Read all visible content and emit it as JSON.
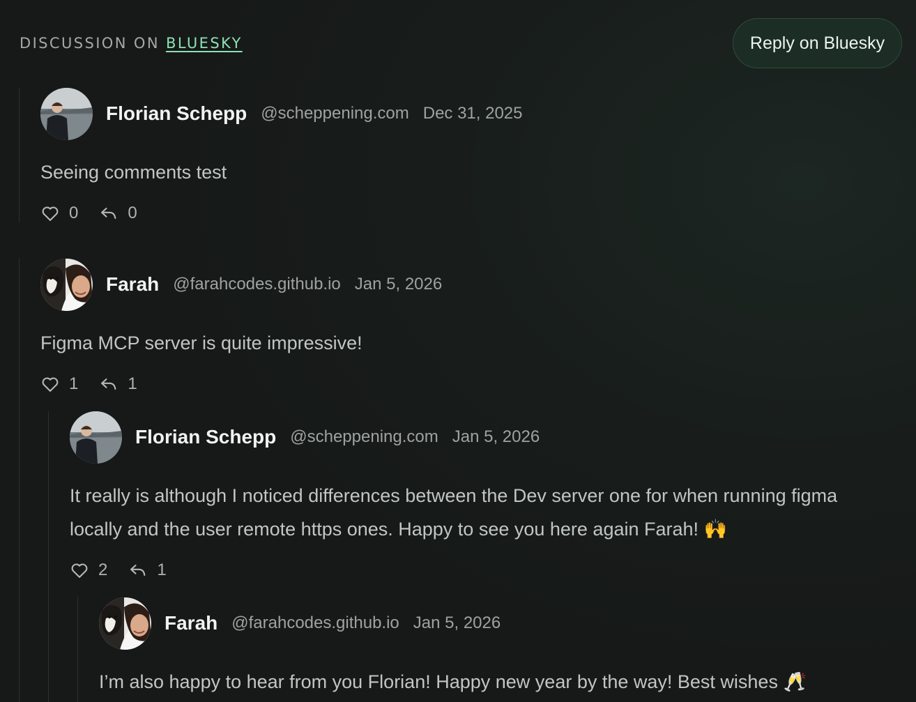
{
  "header": {
    "prefix": "DISCUSSION ON",
    "link_text": "BLUESKY",
    "reply_button": "Reply on Bluesky"
  },
  "colors": {
    "background": "#171a19",
    "accent_link": "#8ee0b3",
    "button_bg": "#1b2d25",
    "text_primary": "#f1f3f1",
    "text_muted": "#9ea3a0"
  },
  "comments": [
    {
      "name": "Florian Schepp",
      "handle": "@scheppening.com",
      "date": "Dec 31, 2025",
      "text": "Seeing comments test",
      "likes": "0",
      "replies": "0",
      "avatar_icon": "person-photo-avatar"
    },
    {
      "name": "Farah",
      "handle": "@farahcodes.github.io",
      "date": "Jan 5, 2026",
      "text": "Figma MCP server is quite impressive!",
      "likes": "1",
      "replies": "1",
      "avatar_icon": "selfie-with-dog-avatar"
    },
    {
      "name": "Florian Schepp",
      "handle": "@scheppening.com",
      "date": "Jan 5, 2026",
      "text": "It really is although I noticed differences between the Dev server one for when running figma locally and the user remote https ones. Happy to see you here again Farah! 🙌",
      "likes": "2",
      "replies": "1",
      "avatar_icon": "person-photo-avatar"
    },
    {
      "name": "Farah",
      "handle": "@farahcodes.github.io",
      "date": "Jan 5, 2026",
      "text": "I’m also happy to hear from you Florian! Happy new year by the way! Best wishes 🥂",
      "avatar_icon": "selfie-with-dog-avatar"
    }
  ]
}
